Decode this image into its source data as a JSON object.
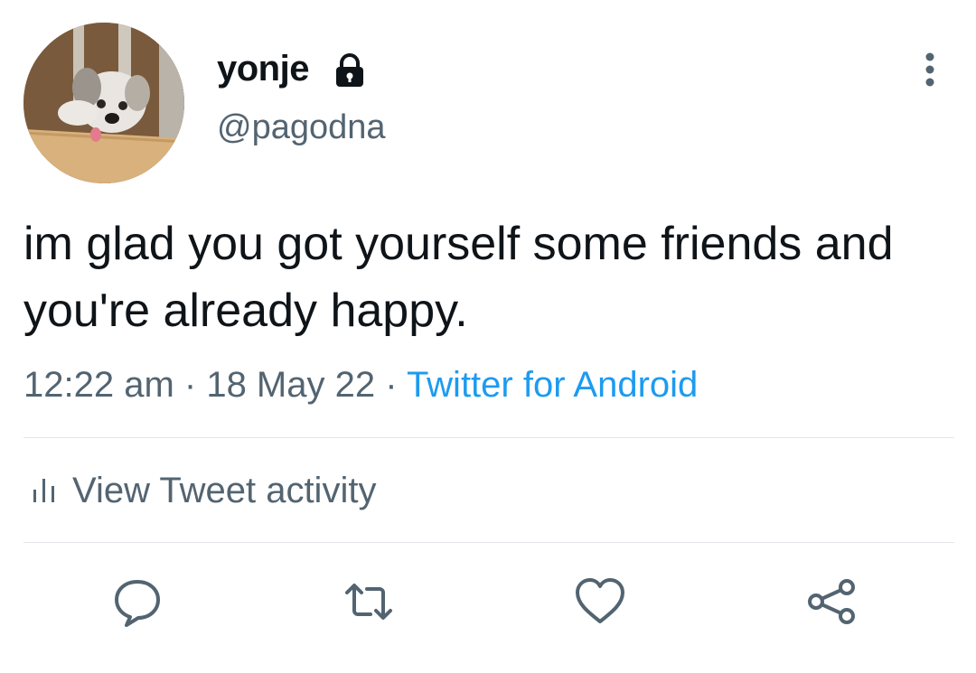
{
  "author": {
    "display_name": "yonje",
    "handle": "@pagodna",
    "protected_icon": "lock-icon"
  },
  "tweet": {
    "text": "im glad you got yourself some friends and you're already happy.",
    "time": "12:22 am",
    "date": "18 May 22",
    "source": "Twitter for Android",
    "separator": " · "
  },
  "activity": {
    "icon": "bar-chart-icon",
    "label": "View Tweet activity"
  },
  "actions": {
    "reply": "comment-icon",
    "retweet": "retweet-icon",
    "like": "heart-icon",
    "share": "share-icon"
  },
  "colors": {
    "text": "#0f1419",
    "secondary": "#536471",
    "link": "#1d9bf0",
    "divider": "#e1e6ea"
  }
}
